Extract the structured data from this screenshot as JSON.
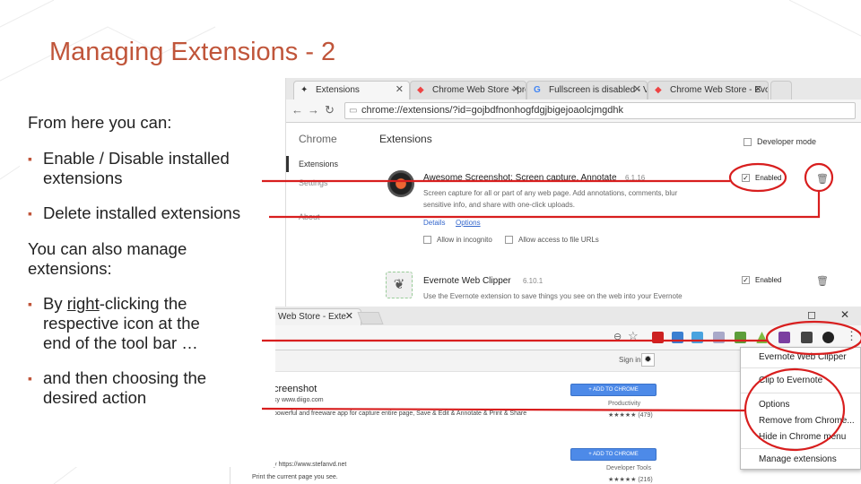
{
  "slide": {
    "title": "Managing Extensions - 2",
    "intro": "From here you can:",
    "bullet1_line1": "Enable / Disable installed",
    "bullet1_line2": "extensions",
    "bullet2": "Delete installed extensions",
    "para2_line1": "You can also manage",
    "para2_line2": "extensions:",
    "bullet3_pre": "By ",
    "bullet3_link": "right",
    "bullet3_post": "-clicking the",
    "bullet3_line2": "respective icon at the",
    "bullet3_line3": "end of the tool bar …",
    "bullet4_line1": "and then choosing the",
    "bullet4_line2": "desired action",
    "accent_color": "#c0553a",
    "annotation_color": "#d81e1e"
  },
  "extensions_window": {
    "tabs": [
      {
        "label": "Extensions",
        "icon": "puzzle-icon"
      },
      {
        "label": "Chrome Web Store - pro",
        "icon": "webstore-icon"
      },
      {
        "label": "Fullscreen is disabled - V",
        "icon": "google-icon"
      },
      {
        "label": "Chrome Web Store - Evo",
        "icon": "webstore-icon"
      }
    ],
    "url": "chrome://extensions/?id=gojbdfnonhogfdgjbigejoaolcjmgdhk",
    "brand": "Chrome",
    "page_title": "Extensions",
    "sidebar": [
      "Extensions",
      "Settings",
      "About"
    ],
    "developer_mode": "Developer mode",
    "ext1": {
      "name": "Awesome Screenshot: Screen capture, Annotate",
      "version": "6.1.16",
      "desc_line1": "Screen capture for all or part of any web page. Add annotations, comments, blur",
      "desc_line2": "sensitive info, and share with one-click uploads.",
      "details": "Details",
      "options": "Options",
      "allow_incognito": "Allow in incognito",
      "allow_file": "Allow access to file URLs",
      "enabled_label": "Enabled"
    },
    "ext2": {
      "name": "Evernote Web Clipper",
      "version": "6.10.1",
      "desc": "Use the Evernote extension to save things you see on the web into your Evernote",
      "enabled_label": "Enabled"
    }
  },
  "store_window": {
    "tab_label": "Web Store - Exte",
    "sign_in": "Sign in",
    "item1_title": "creenshot",
    "item1_sub": "ky www.diigo.com",
    "item1_desc": "powerful and freeware app for capture entire page, Save & Edit & Annotate & Print & Share",
    "item1_category": "Productivity",
    "item1_rating": "★★★★★ (479)",
    "add_button": "+ ADD TO CHROME",
    "item2_sub": "y https://www.stefanvd.net",
    "item2_desc": "Print the current page you see.",
    "item2_category": "Developer Tools",
    "item2_rating": "★★★★★ (216)"
  },
  "context_menu": {
    "items": [
      "Evernote Web Clipper",
      "Clip to Evernote",
      "Options",
      "Remove from Chrome...",
      "Hide in Chrome menu",
      "Manage extensions"
    ]
  }
}
